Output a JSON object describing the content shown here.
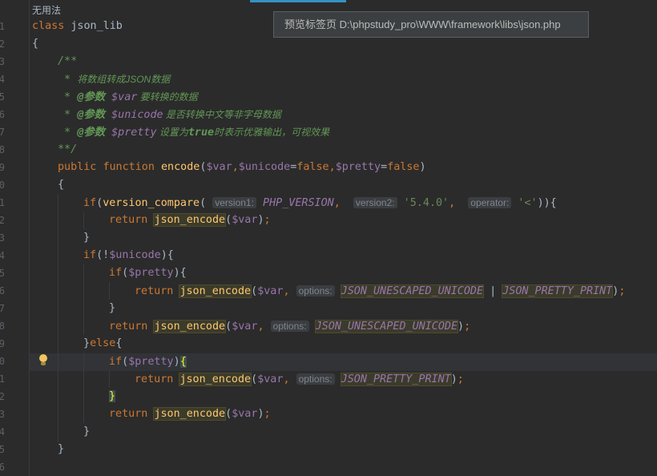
{
  "header_label": "无用法",
  "tooltip": "预览标签页 D:\\phpstudy_pro\\WWW\\framework\\libs\\json.php",
  "gutter_numbers": [
    "1",
    "2",
    "3",
    "4",
    "5",
    "6",
    "7",
    "8",
    "9",
    "0",
    "1",
    "2",
    "3",
    "4",
    "5",
    "6",
    "7",
    "8",
    "9",
    "0",
    "1",
    "2",
    "3",
    "4",
    "5",
    "6"
  ],
  "code": {
    "l1": {
      "kw": "class",
      "name": " json_lib"
    },
    "l2": "{",
    "l3": "/**",
    "l4": {
      "star": " * ",
      "text": "将数组转成JSON数据"
    },
    "l5": {
      "star": " * ",
      "tag": "@参数",
      "var": " $var",
      "text": " 要转换的数据"
    },
    "l6": {
      "star": " * ",
      "tag": "@参数",
      "var": " $unicode",
      "text": " 是否转换中文等非字母数据"
    },
    "l7": {
      "star": " * ",
      "tag": "@参数",
      "var": " $pretty",
      "text": " 设置为",
      "bold": "true",
      "text2": "时表示优雅输出，可视效果"
    },
    "l8": "**/",
    "l9": {
      "kw1": "public",
      "kw2": "function",
      "fn": "encode",
      "p1": "$var",
      "p2": "$unicode",
      "d1": "false",
      "p3": "$pretty",
      "d2": "false"
    },
    "l10": "{",
    "l11": {
      "kw": "if",
      "fn": "version_compare",
      "h1": "version1:",
      "c1": "PHP_VERSION",
      "h2": "version2:",
      "s1": "'5.4.0'",
      "h3": "operator:",
      "s2": "'<'"
    },
    "l12": {
      "kw": "return",
      "fn": "json_encode",
      "v": "$var"
    },
    "l13": "}",
    "l14": {
      "kw": "if",
      "v": "$unicode"
    },
    "l15": {
      "kw": "if",
      "v": "$pretty"
    },
    "l16": {
      "kw": "return",
      "fn": "json_encode",
      "v": "$var",
      "h": "options:",
      "c1": "JSON_UNESCAPED_UNICODE",
      "op": " | ",
      "c2": "JSON_PRETTY_PRINT"
    },
    "l17": "}",
    "l18": {
      "kw": "return",
      "fn": "json_encode",
      "v": "$var",
      "h": "options:",
      "c1": "JSON_UNESCAPED_UNICODE"
    },
    "l19": {
      "kw": "else"
    },
    "l20": {
      "kw": "if",
      "v": "$pretty"
    },
    "l21": {
      "kw": "return",
      "fn": "json_encode",
      "v": "$var",
      "h": "options:",
      "c1": "JSON_PRETTY_PRINT"
    },
    "l22": "}",
    "l23": {
      "kw": "return",
      "fn": "json_encode",
      "v": "$var"
    },
    "l24": "}",
    "l25": "}"
  },
  "icons": {
    "intention": "lightbulb-icon"
  },
  "colors": {
    "background": "#2b2b2b",
    "keyword": "#cc7832",
    "function": "#ffc66d",
    "variable": "#9876aa",
    "string": "#6a8759",
    "comment": "#629755"
  }
}
